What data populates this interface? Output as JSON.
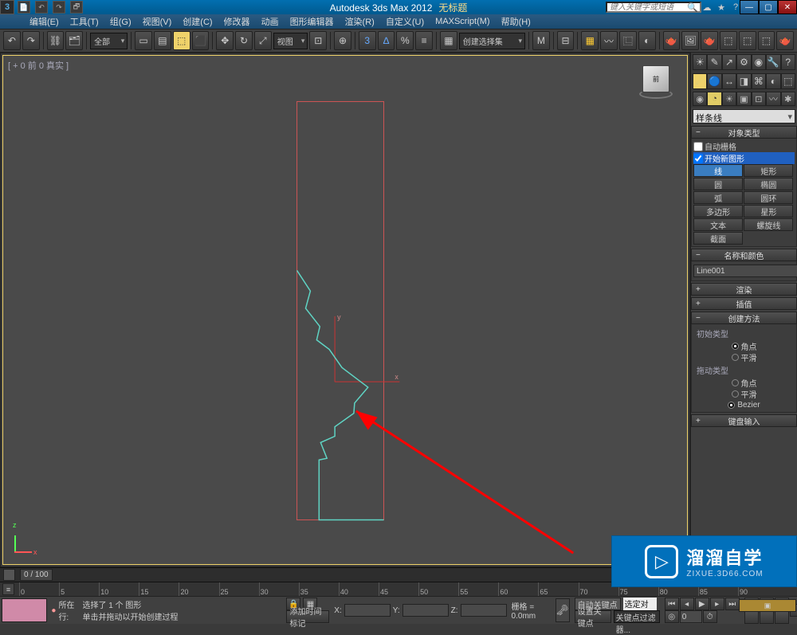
{
  "titlebar": {
    "logo": "3",
    "title": "Autodesk 3ds Max 2012",
    "untitled": "无标题",
    "search_placeholder": "键入关键字或短语"
  },
  "menu": {
    "items": [
      "编辑(E)",
      "工具(T)",
      "组(G)",
      "视图(V)",
      "创建(C)",
      "修改器",
      "动画",
      "图形编辑器",
      "渲染(R)",
      "自定义(U)",
      "MAXScript(M)",
      "帮助(H)"
    ]
  },
  "toolbar": {
    "all": "全部",
    "viewbtn": "视图",
    "selset": "创建选择集",
    "icons": [
      "↶",
      "↷",
      "⛓",
      "🗂",
      "▾",
      "⬚",
      "🖱",
      "⬚",
      "⬜",
      "◉",
      "↻",
      "↗",
      "⬚",
      "◎",
      "⊡",
      "⊞",
      "%",
      "ℹ",
      "∫",
      "☰",
      "▧",
      "◐",
      "▦",
      "⬚",
      "🔒",
      "⬚",
      "3",
      "⊡",
      "✎",
      "⬚",
      "M",
      "⚙",
      "▦",
      "▦",
      "▦",
      "⬚",
      "⬚",
      "⬚",
      "⬚",
      "⬚",
      "▦",
      "🫖"
    ]
  },
  "viewport": {
    "label": "[ + 0 前 0 真实 ]"
  },
  "rightpanel": {
    "iconrow1": [
      "☀",
      "✎",
      "↗",
      "⚙",
      "◉",
      "🔧",
      "?"
    ],
    "tabs": [
      "⊕",
      "🔵",
      "↔",
      "◨",
      "⌘",
      "◐",
      "⬚"
    ],
    "cats": [
      "◉",
      "○",
      "◐",
      "◑",
      "◒",
      "◓",
      "☆",
      "*"
    ],
    "dropdown": "样条线",
    "obj_type_title": "对象类型",
    "autogrid": "自动栅格",
    "newshape": "开始新图形",
    "shapes": [
      {
        "l": "线",
        "r": "矩形"
      },
      {
        "l": "圆",
        "r": "椭圆"
      },
      {
        "l": "弧",
        "r": "圆环"
      },
      {
        "l": "多边形",
        "r": "星形"
      },
      {
        "l": "文本",
        "r": "螺旋线"
      },
      {
        "l": "截面",
        "r": ""
      }
    ],
    "name_title": "名称和颜色",
    "name_value": "Line001",
    "render_title": "渲染",
    "interp_title": "插值",
    "create_title": "创建方法",
    "init_label": "初始类型",
    "init_opts": [
      "角点",
      "平滑"
    ],
    "drag_label": "拖动类型",
    "drag_opts": [
      "角点",
      "平滑",
      "Bezier"
    ],
    "kbd_title": "键盘输入"
  },
  "timeline": {
    "frame": "0 / 100",
    "ticks": [
      "0",
      "5",
      "10",
      "15",
      "20",
      "25",
      "30",
      "35",
      "40",
      "45",
      "50",
      "55",
      "60",
      "65",
      "70",
      "75",
      "80",
      "85",
      "90"
    ]
  },
  "status": {
    "current_row": "所在行:",
    "sel_text": "选择了 1 个 图形",
    "prompt": "单击并拖动以开始创建过程",
    "lock": "🔒",
    "x": "X:",
    "y": "Y:",
    "z": "Z:",
    "addtime": "添加时间标记",
    "grid_label": "栅格 = 0.0mm",
    "autokey": "自动关键点",
    "selobj": "选定对象",
    "setkey": "设置关键点",
    "keyfilter": "关键点过滤器..."
  },
  "watermark": {
    "big": "溜溜自学",
    "url": "ZIXUE.3D66.COM"
  }
}
